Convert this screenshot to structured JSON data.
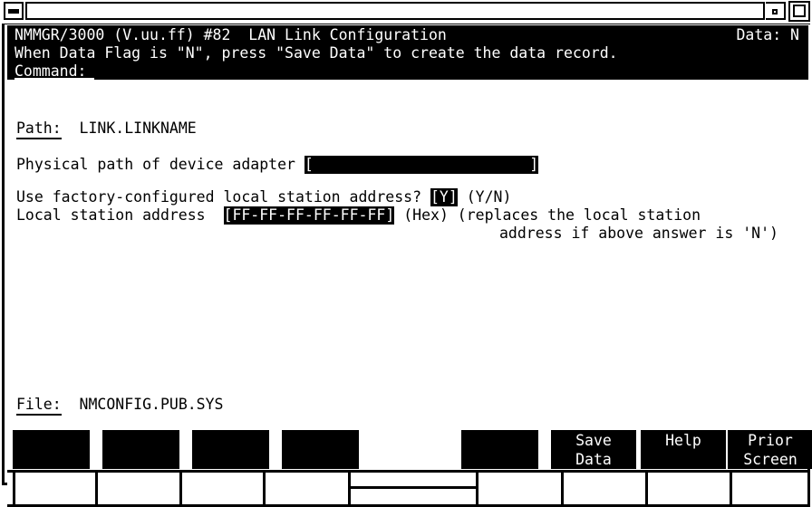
{
  "window": {
    "minimize_label": "minimize",
    "restore_label": "restore",
    "maximize_label": "maximize"
  },
  "header": {
    "line1": "NMMGR/3000 (V.uu.ff) #82  LAN Link Configuration",
    "data_flag": "Data: N",
    "line2": "When Data Flag is \"N\", press \"Save Data\" to create the data record.",
    "command_label": "Command:",
    "command_value": ""
  },
  "form": {
    "path_label": "Path:",
    "path_value": "LINK.LINKNAME",
    "device_adapter_label": "Physical path of device adapter",
    "device_adapter_open": "[",
    "device_adapter_value": "                        ",
    "device_adapter_close": "]",
    "factory_question": "Use factory-configured local station address?",
    "factory_open": "[",
    "factory_value": "Y",
    "factory_close": "]",
    "factory_hint": "(Y/N)",
    "station_label": "Local station address",
    "station_open": "[",
    "station_value": "FF-FF-FF-FF-FF-FF",
    "station_close": "]",
    "station_hint": "(Hex) (replaces the local station",
    "station_hint2": "address if above answer is 'N')",
    "file_label": "File:",
    "file_value": "NMCONFIG.PUB.SYS"
  },
  "function_keys": [
    {
      "id": "f1",
      "line1": "",
      "line2": "",
      "blank": false
    },
    {
      "id": "f2",
      "line1": "",
      "line2": "",
      "blank": false
    },
    {
      "id": "f3",
      "line1": "",
      "line2": "",
      "blank": false
    },
    {
      "id": "f4",
      "line1": "",
      "line2": "",
      "blank": false
    },
    {
      "id": "f5",
      "line1": "",
      "line2": "",
      "blank": true
    },
    {
      "id": "f6",
      "line1": "",
      "line2": "",
      "blank": false
    },
    {
      "id": "f7",
      "line1": "Save",
      "line2": "Data",
      "blank": false
    },
    {
      "id": "f8",
      "line1": "Help",
      "line2": "",
      "blank": false
    },
    {
      "id": "f9",
      "line1": "Prior",
      "line2": "Screen",
      "blank": false
    }
  ],
  "status_cells": [
    {
      "id": "s1",
      "text": "",
      "split": false
    },
    {
      "id": "s2",
      "text": "",
      "split": false
    },
    {
      "id": "s3",
      "text": "",
      "split": false
    },
    {
      "id": "s4",
      "text": "",
      "split": false
    },
    {
      "id": "s5",
      "text": "",
      "split": true
    },
    {
      "id": "s6",
      "text": "",
      "split": false
    },
    {
      "id": "s7",
      "text": "",
      "split": false
    },
    {
      "id": "s8",
      "text": "",
      "split": false
    },
    {
      "id": "s9",
      "text": "",
      "split": false
    }
  ],
  "colors": {
    "background": "#ffffff",
    "foreground": "#000000",
    "inverse_background": "#000000",
    "inverse_foreground": "#ffffff"
  }
}
